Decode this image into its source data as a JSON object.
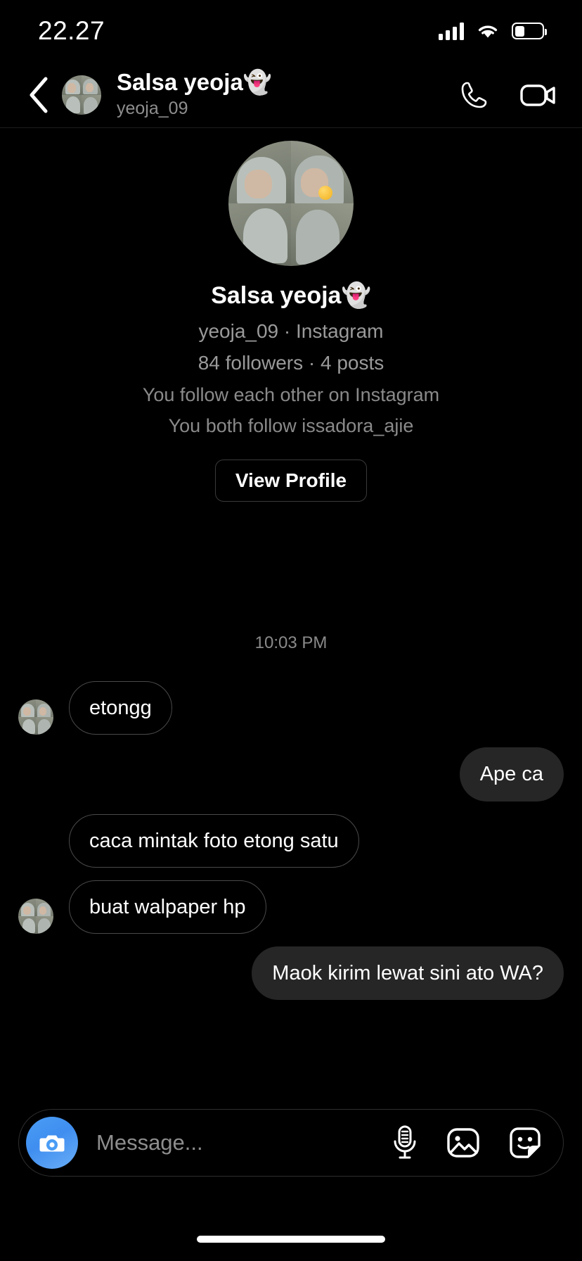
{
  "status_bar": {
    "time": "22.27",
    "signal_icon": "cellular-signal-icon",
    "wifi_icon": "wifi-icon",
    "battery_icon": "battery-icon",
    "battery_level_pct": 36
  },
  "header": {
    "back_icon": "chevron-left-icon",
    "avatar_icon": "contact-avatar",
    "display_name": "Salsa yeoja👻",
    "username": "yeoja_09",
    "call_icon": "phone-icon",
    "video_icon": "video-camera-icon"
  },
  "profile": {
    "avatar_icon": "profile-avatar-large",
    "display_name": "Salsa yeoja👻",
    "handle_line": "yeoja_09 · Instagram",
    "stats_line": "84 followers · 4 posts",
    "mutual_line_1": "You follow each other on Instagram",
    "mutual_line_2": "You both follow issadora_ajie",
    "view_profile_label": "View Profile"
  },
  "thread": {
    "timestamp": "10:03 PM",
    "messages": [
      {
        "text": "etongg",
        "side": "in",
        "show_avatar": true
      },
      {
        "text": "Ape ca",
        "side": "out",
        "show_avatar": false
      },
      {
        "text": "caca mintak foto etong satu",
        "side": "in",
        "show_avatar": false
      },
      {
        "text": "buat walpaper hp",
        "side": "in",
        "show_avatar": true
      },
      {
        "text": "Maok kirim lewat sini ato WA?",
        "side": "out",
        "show_avatar": false
      }
    ]
  },
  "composer": {
    "camera_icon": "camera-icon",
    "placeholder": "Message...",
    "mic_icon": "microphone-icon",
    "gallery_icon": "image-gallery-icon",
    "sticker_icon": "sticker-icon"
  },
  "colors": {
    "background": "#000000",
    "outgoing_bubble": "#262626",
    "incoming_border": "#4a4a4a",
    "secondary_text": "#8e8e8e",
    "camera_blue": "#4a9df5"
  }
}
